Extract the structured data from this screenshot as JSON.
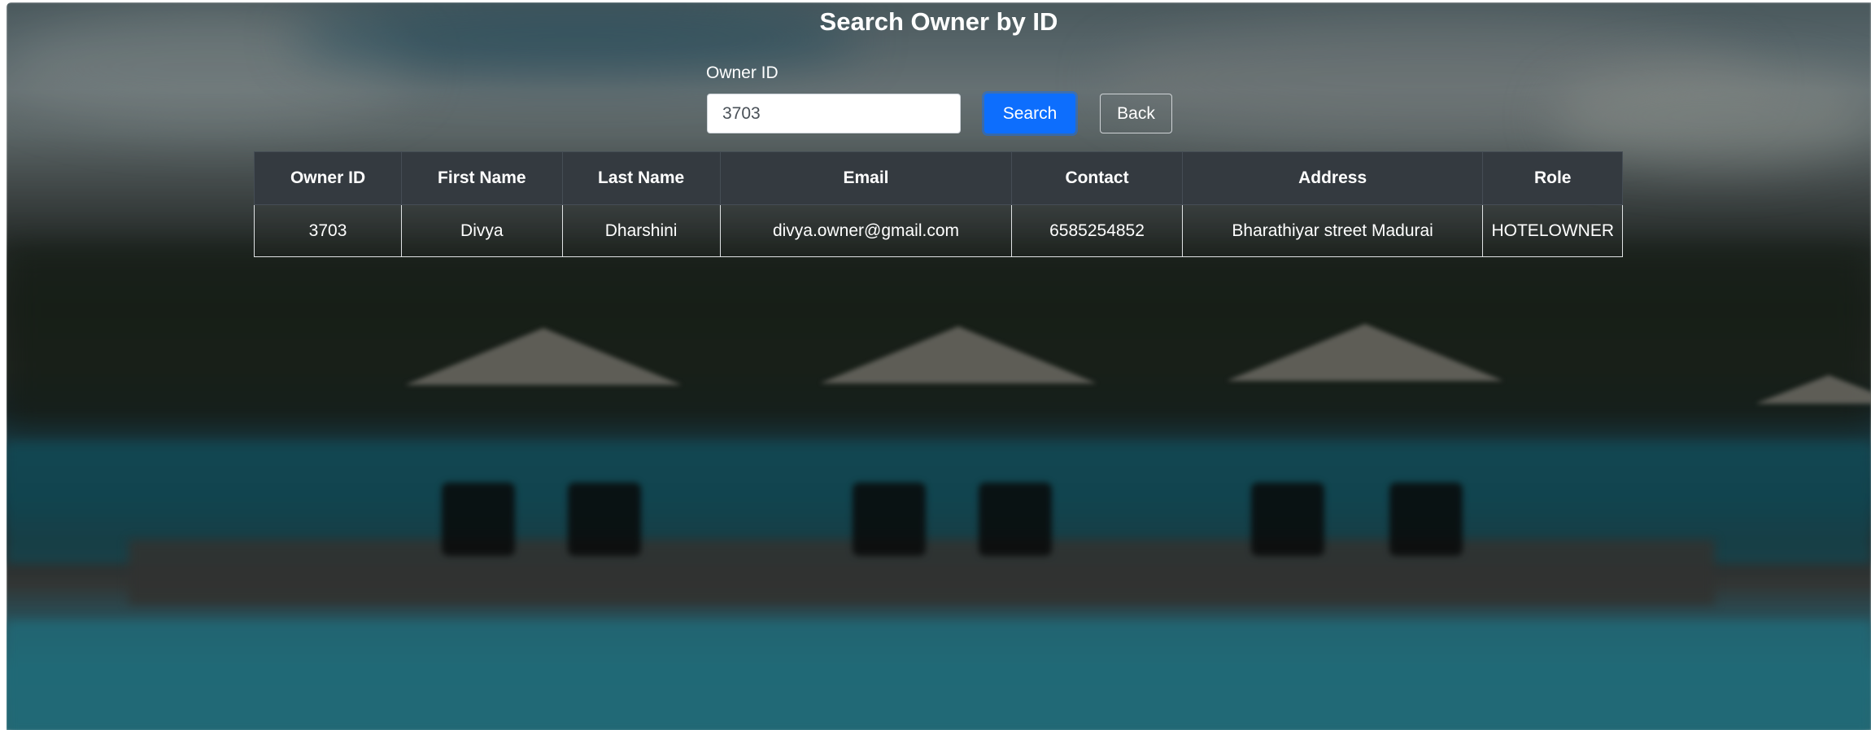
{
  "page": {
    "title": "Search Owner by ID"
  },
  "search": {
    "label": "Owner ID",
    "value": "3703",
    "search_label": "Search",
    "back_label": "Back"
  },
  "table": {
    "columns": [
      "Owner ID",
      "First Name",
      "Last Name",
      "Email",
      "Contact",
      "Address",
      "Role"
    ],
    "rows": [
      [
        "3703",
        "Divya",
        "Dharshini",
        "divya.owner@gmail.com",
        "6585254852",
        "Bharathiyar street Madurai",
        "HOTELOWNER"
      ]
    ]
  },
  "colors": {
    "search_button": "#0d6efd",
    "table_header": "#343a40",
    "text": "#ffffff"
  }
}
